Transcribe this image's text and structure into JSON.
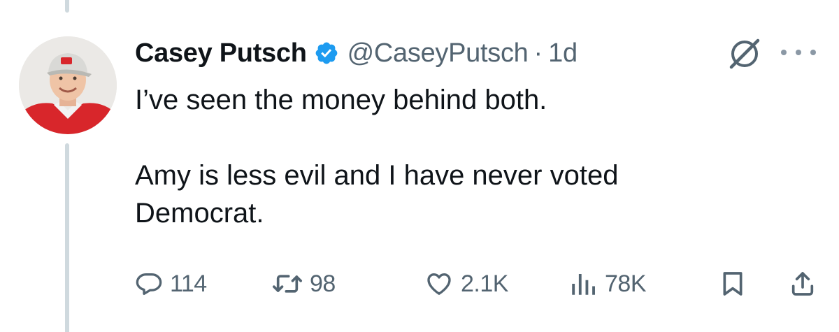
{
  "tweet": {
    "author": {
      "display_name": "Casey Putsch",
      "handle": "@CaseyPutsch",
      "verified_icon": "verified-badge-icon"
    },
    "separator": "·",
    "time": "1d",
    "text_lines": [
      "I’ve seen the money behind both.",
      "Amy is less evil and I have never voted",
      "Democrat."
    ],
    "actions": {
      "replies": "114",
      "reposts": "98",
      "likes": "2.1K",
      "views": "78K"
    },
    "icons": [
      "grok-icon",
      "more-icon",
      "reply-icon",
      "repost-icon",
      "like-icon",
      "views-icon",
      "bookmark-icon",
      "share-icon"
    ]
  },
  "colors": {
    "text": "#0f1419",
    "secondary": "#536471",
    "verified": "#1d9bf0",
    "thread_line": "#cfd9de"
  }
}
